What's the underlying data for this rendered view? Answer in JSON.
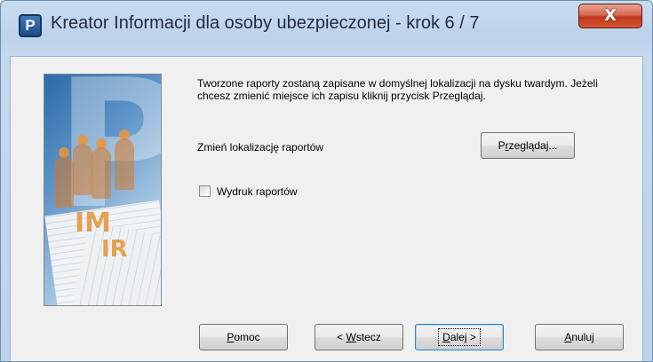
{
  "window": {
    "title": "Kreator Informacji dla osoby ubezpieczonej  - krok 6 / 7",
    "icon": "P",
    "close_label": "X"
  },
  "main": {
    "info_text": "Tworzone raporty zostaną zapisane w domyślnej lokalizacji na dysku twardym. Jeżeli chcesz zmienić miejsce ich zapisu kliknij przycisk Przeglądaj.",
    "change_location_label": "Zmień lokalizację raportów",
    "print_reports_label": "Wydruk raportów",
    "print_reports_checked": false
  },
  "buttons": {
    "browse": {
      "accel": "r",
      "pre": "P",
      "post": "zeglądaj..."
    },
    "help": {
      "accel": "P",
      "pre": "",
      "post": "omoc"
    },
    "back": {
      "accel": "W",
      "pre": "< ",
      "post": "stecz"
    },
    "next": {
      "accel": "D",
      "pre": "",
      "post": "alej >"
    },
    "cancel": {
      "accel": "A",
      "pre": "",
      "post": "nuluj"
    }
  },
  "image": {
    "letter": "P",
    "mark_im": "IM",
    "mark_ir": "IR"
  },
  "colors": {
    "title_bar": "#c4d8ee",
    "dialog_bg": "#f0f0f0",
    "close_button": "#c0381d",
    "default_button_border": "#3c7fb1"
  }
}
